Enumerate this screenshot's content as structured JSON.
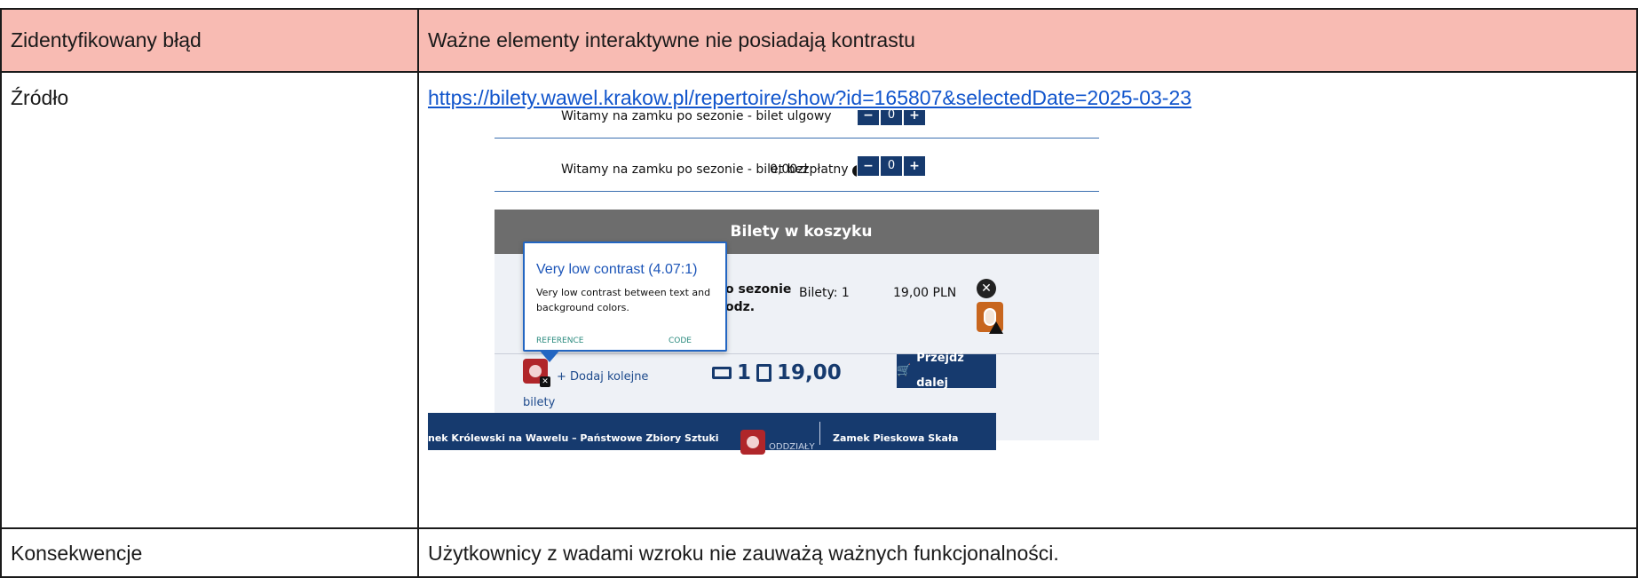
{
  "report": {
    "row1_label": "Zidentyfikowany błąd",
    "row1_value": "Ważne elementy interaktywne nie posiadają kontrastu",
    "row2_label": "Źródło",
    "row2_link": "https://bilety.wawel.krakow.pl/repertoire/show?id=165807&selectedDate=2025-03-23",
    "row3_label": "Konsekwencje",
    "row3_value": "Użytkownicy z wadami wzroku nie zauważą ważnych funkcjonalności."
  },
  "screenshot": {
    "cut_row_text": "Witamy na zamku po sezonie - bilet ulgowy",
    "ticket_name": "Witamy na zamku po sezonie - bilet bezpłatny",
    "ticket_price": "0,00zł",
    "qty_minus": "−",
    "qty_value": "0",
    "qty_plus": "+",
    "cart_header": "Bilety w koszyku",
    "cart_item_line1": "po sezonie",
    "cart_item_line2": "godz.",
    "cart_tickets": "Bilety: 1",
    "cart_price": "19,00 PLN",
    "remove": "✕",
    "tooltip_title": "Very low contrast (4.07:1)",
    "tooltip_body": "Very low contrast between text and background colors.",
    "tooltip_reference": "REFERENCE",
    "tooltip_code": "CODE",
    "add_more_line1": "+ Dodaj kolejne",
    "add_more_line2": "bilety",
    "summary_count": "1",
    "summary_total": "19,00",
    "proceed_button": "Przejdź dalej",
    "footer_left": "nek Królewski na Wawelu – Państwowe Zbiory Sztuki",
    "footer_branches": "ODDZIAŁY",
    "footer_right": "Zamek Pieskowa Skała"
  },
  "colors": {
    "header_bg": "#f8bbb3",
    "link": "#1155cc",
    "navy": "#163a6e",
    "tooltip_border": "#2366c2",
    "error_badge": "#b0262a",
    "mouse_badge": "#c8661e"
  }
}
